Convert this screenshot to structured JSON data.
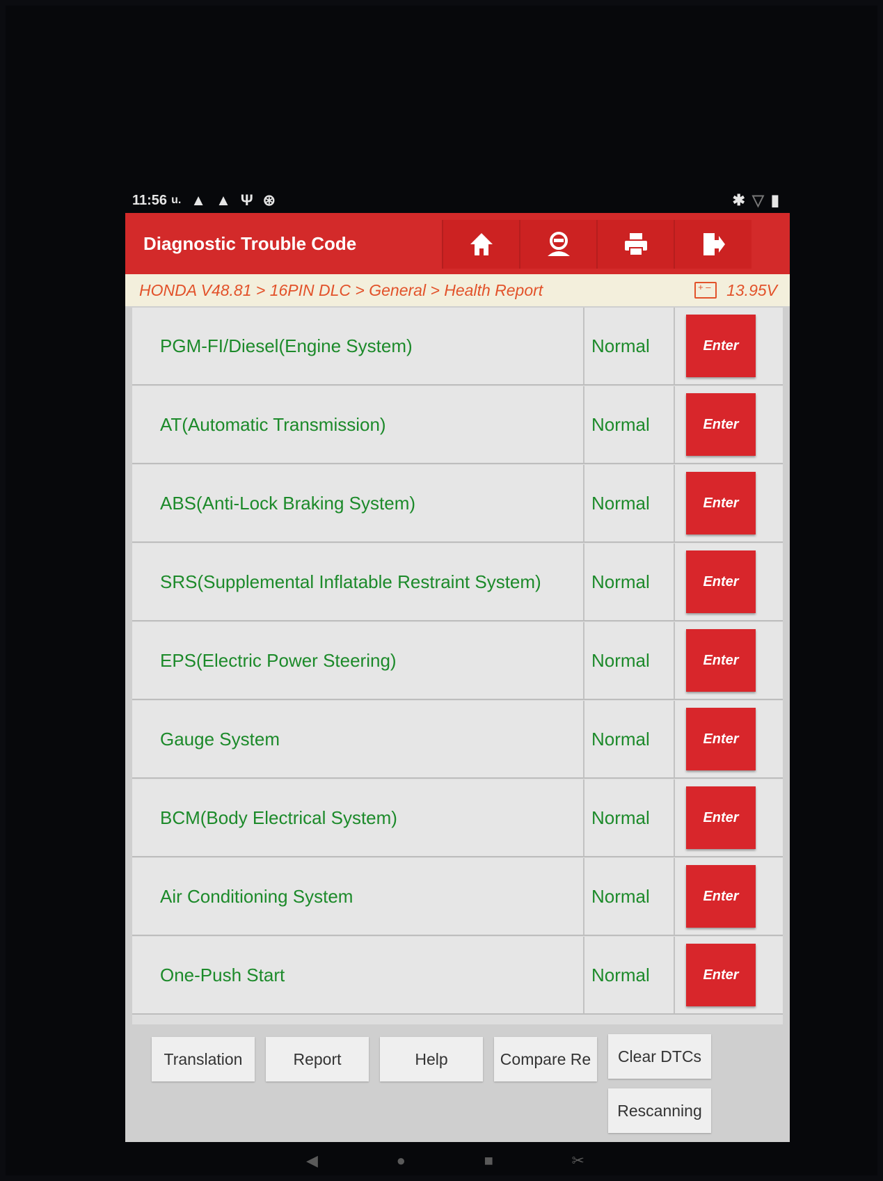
{
  "status_bar": {
    "time": "11:56",
    "indicator": "u.",
    "left_icons": [
      "warning-icon",
      "warning-icon",
      "usb-icon",
      "bluetooth-circle-icon"
    ],
    "right_icons": [
      "bluetooth-icon",
      "wifi-icon",
      "battery-icon"
    ]
  },
  "header": {
    "title": "Diagnostic Trouble Code",
    "buttons": [
      "home-icon",
      "profile-icon",
      "print-icon",
      "exit-icon"
    ]
  },
  "breadcrumb": {
    "path": "HONDA V48.81 > 16PIN DLC > General > Health Report",
    "voltage": "13.95V"
  },
  "systems": [
    {
      "name": "PGM-FI/Diesel(Engine System)",
      "status": "Normal",
      "action": "Enter"
    },
    {
      "name": "AT(Automatic Transmission)",
      "status": "Normal",
      "action": "Enter"
    },
    {
      "name": "ABS(Anti-Lock Braking System)",
      "status": "Normal",
      "action": "Enter"
    },
    {
      "name": "SRS(Supplemental Inflatable Restraint System)",
      "status": "Normal",
      "action": "Enter"
    },
    {
      "name": "EPS(Electric Power Steering)",
      "status": "Normal",
      "action": "Enter"
    },
    {
      "name": "Gauge System",
      "status": "Normal",
      "action": "Enter"
    },
    {
      "name": "BCM(Body Electrical System)",
      "status": "Normal",
      "action": "Enter"
    },
    {
      "name": "Air Conditioning System",
      "status": "Normal",
      "action": "Enter"
    },
    {
      "name": "One-Push Start",
      "status": "Normal",
      "action": "Enter"
    }
  ],
  "footer": {
    "translation": "Translation",
    "report": "Report",
    "help": "Help",
    "compare": "Compare Re",
    "clear_dtcs": "Clear DTCs",
    "rescanning": "Rescanning"
  },
  "nav": [
    "back-icon",
    "home-circle-icon",
    "recents-icon",
    "screenshot-icon"
  ],
  "colors": {
    "header_red": "#d32a2a",
    "text_green": "#1c8a2a",
    "crumb_orange": "#e2522a",
    "enter_red": "#d8262b"
  }
}
